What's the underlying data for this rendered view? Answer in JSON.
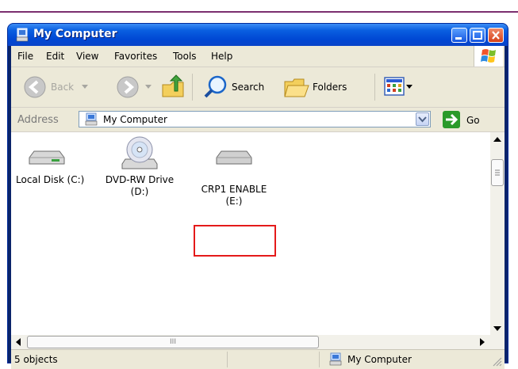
{
  "window": {
    "title": "My Computer"
  },
  "menu": [
    "File",
    "Edit",
    "View",
    "Favorites",
    "Tools",
    "Help"
  ],
  "toolbar": {
    "back": "Back",
    "search": "Search",
    "folders": "Folders"
  },
  "address": {
    "label": "Address",
    "value": "My Computer",
    "go": "Go"
  },
  "items": [
    {
      "line1": "Local Disk (C:)",
      "line2": "",
      "icon": "hard-disk-icon"
    },
    {
      "line1": "DVD-RW Drive",
      "line2": "(D:)",
      "icon": "dvd-drive-icon"
    },
    {
      "line1": "CRP1 ENABLE",
      "line2": "(E:)",
      "icon": "removable-drive-icon"
    }
  ],
  "scroll": {
    "thumb_grip": "III"
  },
  "status": {
    "objects": "5 objects",
    "location": "My Computer"
  }
}
